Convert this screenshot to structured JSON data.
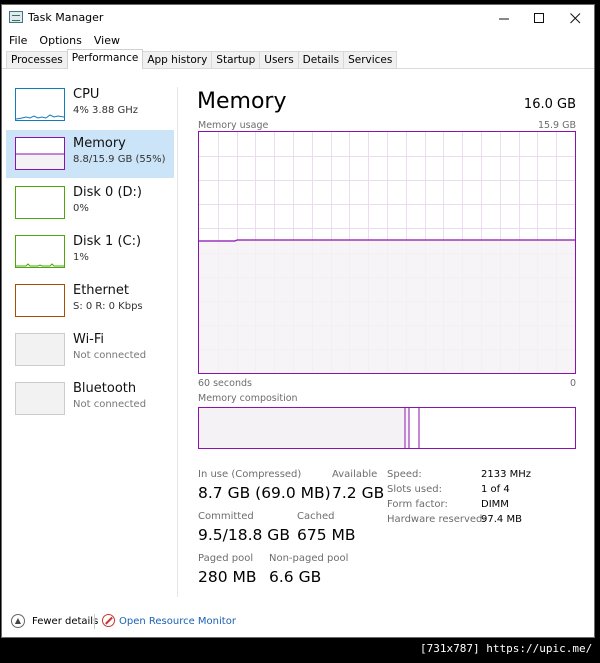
{
  "window": {
    "title": "Task Manager"
  },
  "menu": [
    "File",
    "Options",
    "View"
  ],
  "tabs": [
    "Processes",
    "Performance",
    "App history",
    "Startup",
    "Users",
    "Details",
    "Services"
  ],
  "sidebar": {
    "items": [
      {
        "name": "CPU",
        "sub": "4%  3.88 GHz",
        "color": "#117dbb"
      },
      {
        "name": "Memory",
        "sub": "8.8/15.9 GB (55%)",
        "color": "#8b12ae"
      },
      {
        "name": "Disk 0 (D:)",
        "sub": "0%",
        "color": "#4da60c"
      },
      {
        "name": "Disk 1 (C:)",
        "sub": "1%",
        "color": "#4da60c"
      },
      {
        "name": "Ethernet",
        "sub": "S: 0  R: 0 Kbps",
        "color": "#a74f01"
      },
      {
        "name": "Wi-Fi",
        "sub": "Not connected",
        "color": "#cccccc"
      },
      {
        "name": "Bluetooth",
        "sub": "Not connected",
        "color": "#cccccc"
      }
    ]
  },
  "main": {
    "title": "Memory",
    "total": "16.0 GB",
    "usage_label": "Memory usage",
    "usage_max": "15.9 GB",
    "time_left": "60 seconds",
    "time_right": "0",
    "composition_label": "Memory composition",
    "usage_fraction": 0.55,
    "stats": {
      "in_use_label": "In use (Compressed)",
      "in_use_value": "8.7 GB (69.0 MB)",
      "available_label": "Available",
      "available_value": "7.2 GB",
      "committed_label": "Committed",
      "committed_value": "9.5/18.8 GB",
      "cached_label": "Cached",
      "cached_value": "675 MB",
      "paged_label": "Paged pool",
      "paged_value": "280 MB",
      "nonpaged_label": "Non-paged pool",
      "nonpaged_value": "6.6 GB"
    },
    "specs": {
      "speed_label": "Speed:",
      "speed_value": "2133 MHz",
      "slots_label": "Slots used:",
      "slots_value": "1 of 4",
      "form_label": "Form factor:",
      "form_value": "DIMM",
      "hw_label": "Hardware reserved:",
      "hw_value": "97.4 MB"
    }
  },
  "footer": {
    "fewer_details": "Fewer details",
    "resource_monitor": "Open Resource Monitor"
  },
  "watermark": "[731x787] https://upic.me/",
  "colors": {
    "memory_accent": "#8b12ae",
    "memory_fill": "#f4f2f4",
    "selected": "#cce4f7",
    "link": "#1a5fb4"
  }
}
